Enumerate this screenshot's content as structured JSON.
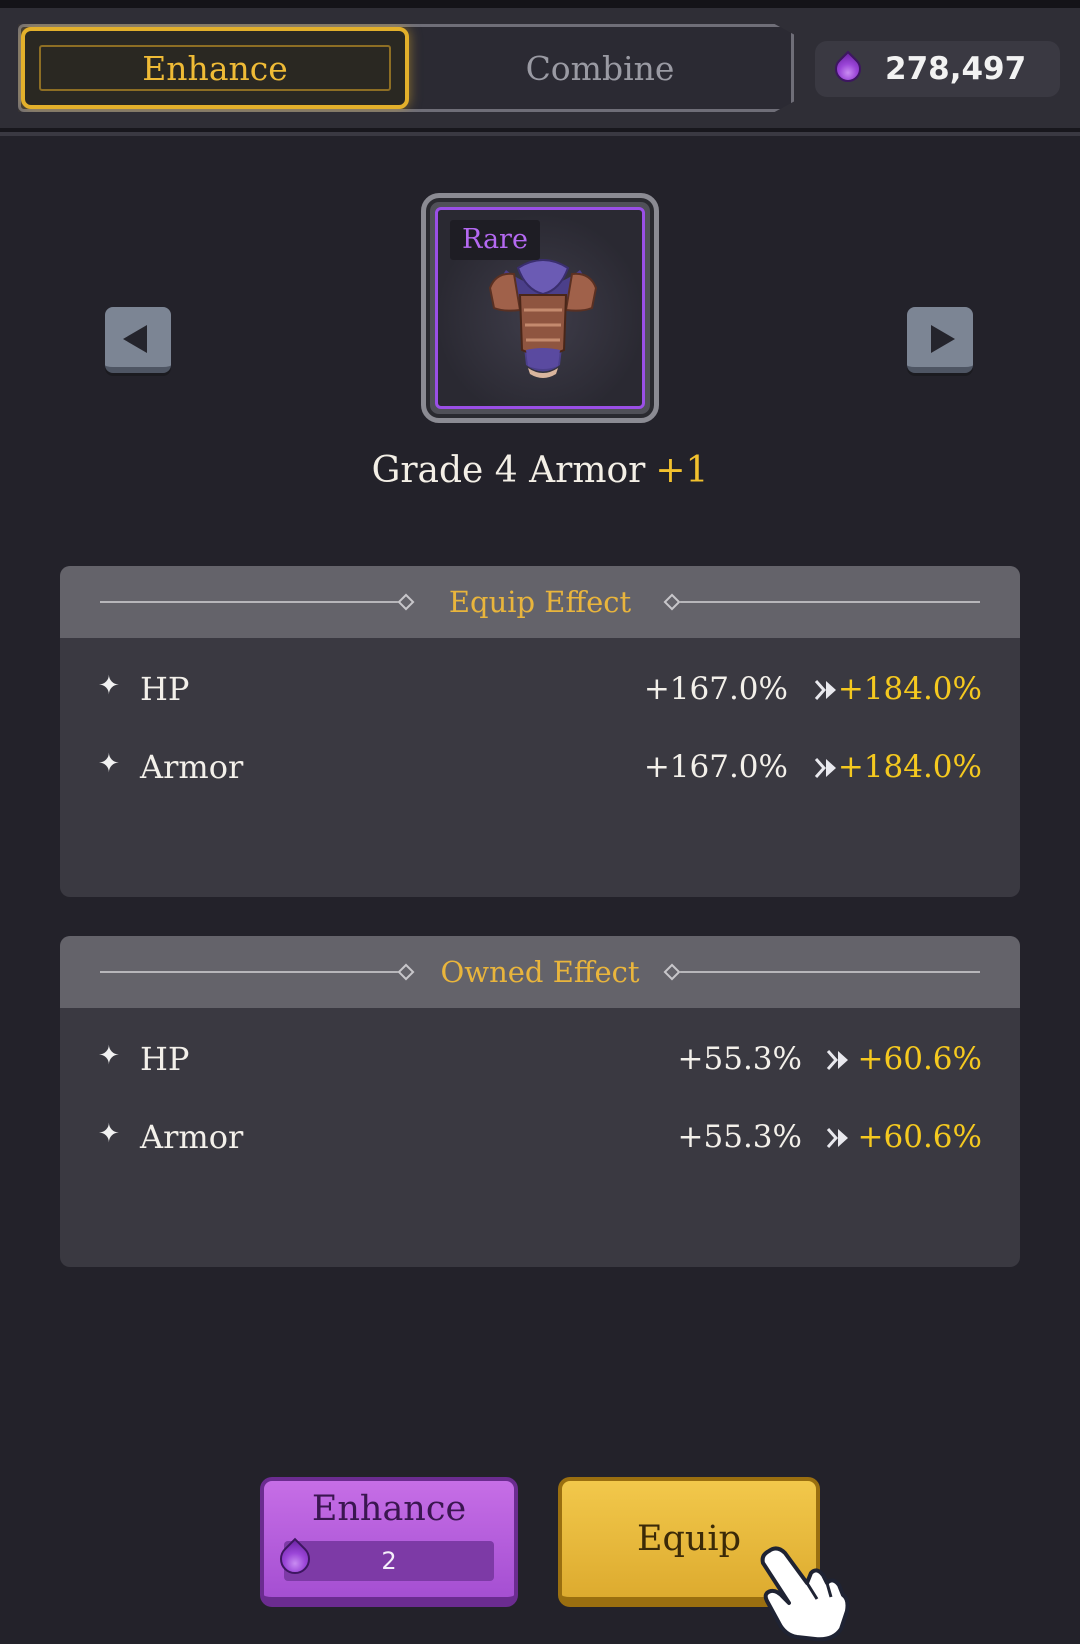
{
  "tabs": [
    {
      "label": "Enhance",
      "active": true
    },
    {
      "label": "Combine",
      "active": false
    }
  ],
  "currency": {
    "icon": "purple-essence-drop-icon",
    "value": "278,497"
  },
  "navigation": {
    "prev_icon": "arrow-left-icon",
    "next_icon": "arrow-right-icon"
  },
  "item": {
    "rarity": "Rare",
    "rarity_color": "#b569f2",
    "image": "armor-icon",
    "name": "Grade 4 Armor",
    "level": "+1"
  },
  "equip_effect": {
    "title": "Equip Effect",
    "stats": [
      {
        "name": "HP",
        "before": "+167.0%",
        "after": "+184.0%"
      },
      {
        "name": "Armor",
        "before": "+167.0%",
        "after": "+184.0%"
      }
    ]
  },
  "owned_effect": {
    "title": "Owned Effect",
    "stats": [
      {
        "name": "HP",
        "before": "+55.3%",
        "after": "+60.6%"
      },
      {
        "name": "Armor",
        "before": "+55.3%",
        "after": "+60.6%"
      }
    ]
  },
  "buttons": {
    "enhance": {
      "label": "Enhance",
      "cost": "2",
      "cost_icon": "purple-essence-drop-icon"
    },
    "equip": {
      "label": "Equip"
    }
  },
  "colors": {
    "accent_gold": "#efbb36",
    "upgrade_value": "#f5c91f",
    "enhance_button": "#b95fe0",
    "equip_button": "#e9b83c"
  }
}
